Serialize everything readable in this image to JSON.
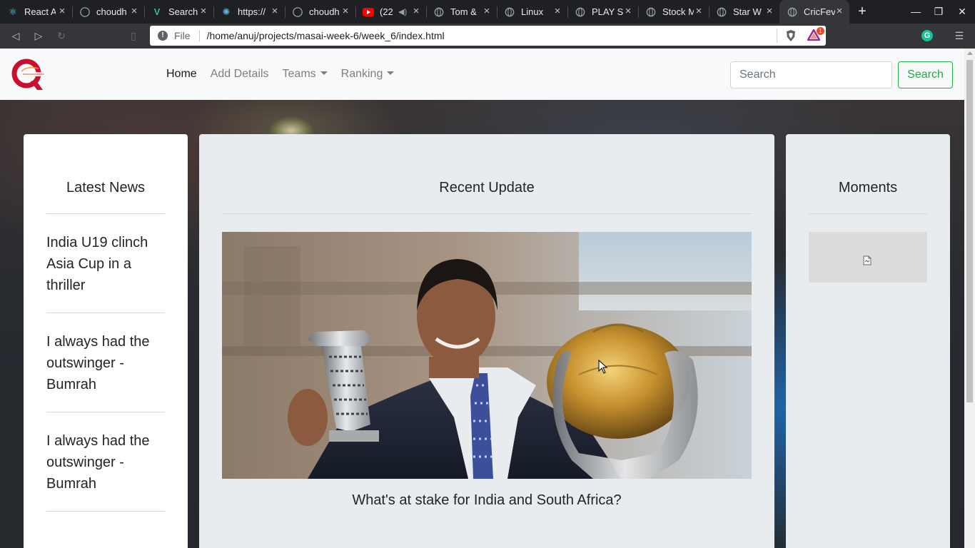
{
  "browser": {
    "tabs": [
      {
        "title": "React A",
        "icon": "react-icon"
      },
      {
        "title": "choudh",
        "icon": "github-icon"
      },
      {
        "title": "Search",
        "icon": "vue-icon"
      },
      {
        "title": "https://",
        "icon": "atom-icon"
      },
      {
        "title": "choudh",
        "icon": "github-icon"
      },
      {
        "title": "(22",
        "icon": "youtube-icon"
      },
      {
        "title": "Tom &",
        "icon": "globe-icon"
      },
      {
        "title": "Linux",
        "icon": "globe-icon"
      },
      {
        "title": "PLAY S",
        "icon": "globe-icon"
      },
      {
        "title": "Stock M",
        "icon": "globe-icon"
      },
      {
        "title": "Star W",
        "icon": "globe-icon"
      },
      {
        "title": "CricFev",
        "icon": "globe-icon",
        "active": true
      }
    ],
    "address": {
      "scheme_label": "File",
      "url": "/home/anuj/projects/masai-week-6/week_6/index.html"
    },
    "rewards_badge": "1",
    "grammarly_letter": "G",
    "accent": "#e8eaed"
  },
  "site": {
    "navbar": {
      "links": [
        {
          "label": "Home",
          "active": true
        },
        {
          "label": "Add Details"
        },
        {
          "label": "Teams",
          "dropdown": true
        },
        {
          "label": "Ranking",
          "dropdown": true
        }
      ],
      "search_placeholder": "Search",
      "search_button": "Search",
      "button_color": "#28a745"
    },
    "latest_news": {
      "title": "Latest News",
      "items": [
        "India U19 clinch Asia Cup in a thriller",
        "I always had the outswinger - Bumrah",
        "I always had the outswinger - Bumrah"
      ]
    },
    "recent_update": {
      "title": "Recent Update",
      "caption": "What's at stake for India and South Africa?"
    },
    "moments": {
      "title": "Moments"
    }
  }
}
